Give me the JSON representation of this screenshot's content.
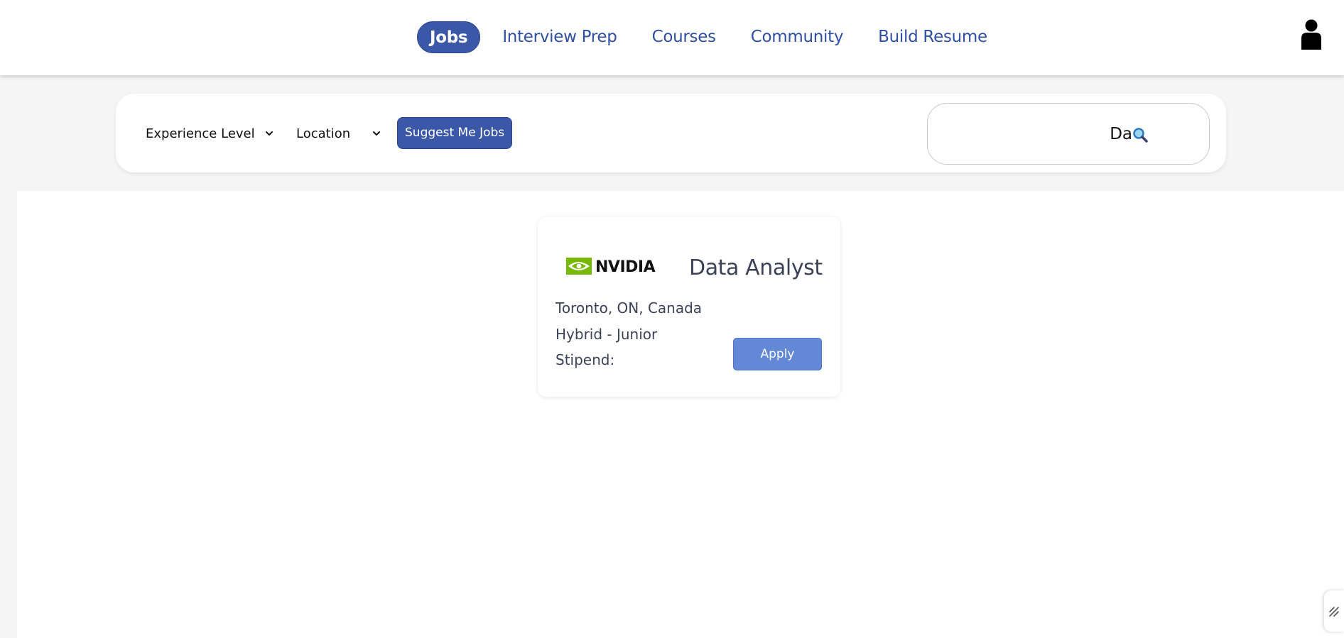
{
  "nav": {
    "items": [
      {
        "label": "Jobs",
        "active": true
      },
      {
        "label": "Interview Prep",
        "active": false
      },
      {
        "label": "Courses",
        "active": false
      },
      {
        "label": "Community",
        "active": false
      },
      {
        "label": "Build Resume",
        "active": false
      }
    ],
    "avatar_icon": "user-icon"
  },
  "filters": {
    "experience_label": "Experience Level",
    "location_label": "Location",
    "suggest_label": "Suggest Me Jobs",
    "search_value": "Da",
    "search_icon": "magnifier-icon"
  },
  "job": {
    "company_logo": "NVIDIA",
    "title": "Data Analyst",
    "location": "Toronto, ON, Canada",
    "work_type": "Hybrid - Junior",
    "stipend": "Stipend:",
    "apply_label": "Apply"
  },
  "colors": {
    "primary": "#3a57a8",
    "apply": "#6388d6",
    "nav_text": "#2f4fa3",
    "nvidia_green": "#76b900"
  }
}
